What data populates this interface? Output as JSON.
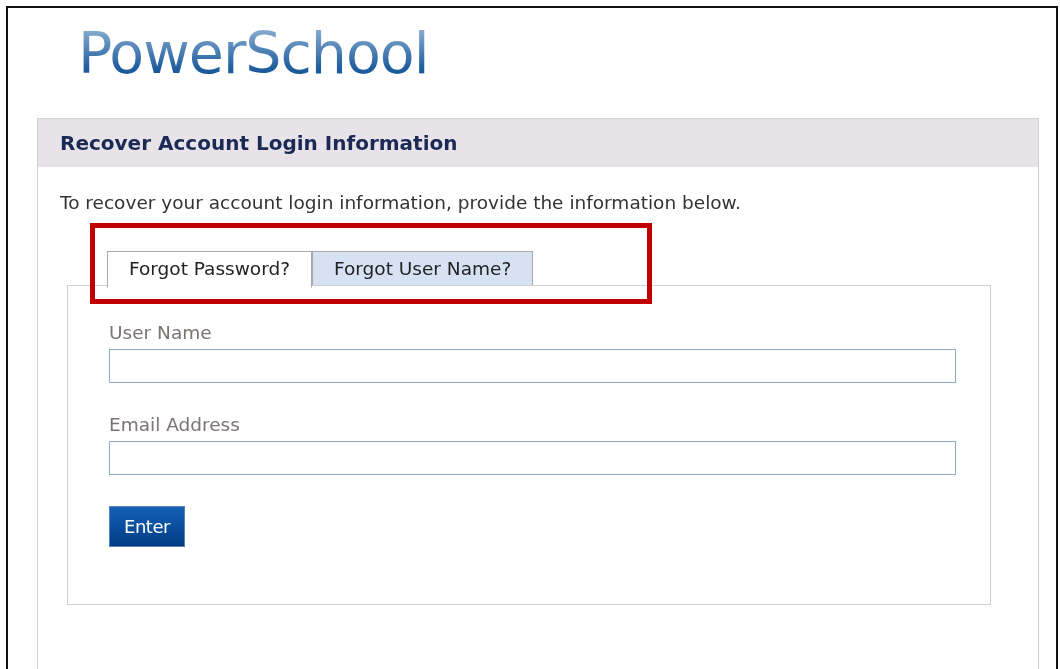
{
  "logo": {
    "text": "PowerSchool"
  },
  "panel": {
    "title": "Recover Account Login Information",
    "intro": "To recover your account login information, provide the information below."
  },
  "tabs": [
    {
      "label": "Forgot Password?",
      "selected": true
    },
    {
      "label": "Forgot User Name?",
      "selected": false
    }
  ],
  "fields": [
    {
      "label": "User Name"
    },
    {
      "label": "Email Address"
    }
  ],
  "buttons": [
    {
      "label": "Enter"
    }
  ],
  "annotation": {
    "kind": "highlight-box"
  }
}
